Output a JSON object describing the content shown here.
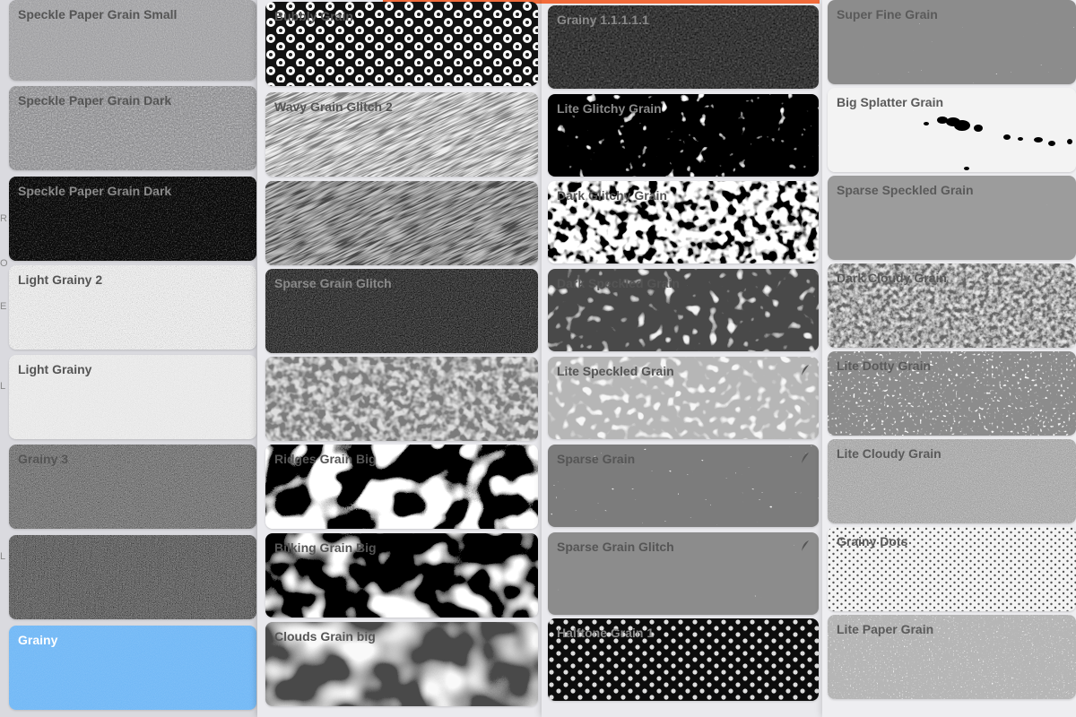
{
  "ui": {
    "accent_color": "#f26b3a",
    "selected_color": "#6ab4f5",
    "edge_letters": [
      "R",
      "O",
      "E",
      "L",
      "L"
    ]
  },
  "columns": [
    {
      "name": "column-1",
      "brushes": [
        {
          "label": "Speckle Paper Grain Small",
          "texture": "gray-speckle-light",
          "selected": false
        },
        {
          "label": "Speckle Paper Grain Dark",
          "texture": "gray-speckle-mid",
          "selected": false
        },
        {
          "label": "Speckle Paper Grain Dark",
          "texture": "dark-speckle",
          "selected": false
        },
        {
          "label": "Light Grainy 2",
          "texture": "light-noise",
          "selected": false
        },
        {
          "label": "Light Grainy",
          "texture": "very-light-noise",
          "selected": false
        },
        {
          "label": "Grainy 3",
          "texture": "mid-noise",
          "selected": false
        },
        {
          "label": "",
          "texture": "mid-noise-dark",
          "selected": false
        },
        {
          "label": "Grainy",
          "texture": "blue-noise",
          "selected": true
        }
      ]
    },
    {
      "name": "column-2",
      "brushes": [
        {
          "label": "Bubbly Grain",
          "texture": "bubbles",
          "selected": false
        },
        {
          "label": "Wavy Grain Glitch 2",
          "texture": "diagonal-streaks-light",
          "selected": false
        },
        {
          "label": "",
          "texture": "diagonal-streaks-dark",
          "selected": false
        },
        {
          "label": "Sparse Grain Glitch",
          "texture": "dark-vignette-noise",
          "selected": false
        },
        {
          "label": "",
          "texture": "mottled-gray",
          "selected": false
        },
        {
          "label": "Ridges Grain Big",
          "texture": "ridges",
          "selected": false
        },
        {
          "label": "Bilking Grain Big",
          "texture": "blobs",
          "selected": false
        },
        {
          "label": "Clouds Grain big",
          "texture": "clouds",
          "selected": false
        }
      ]
    },
    {
      "name": "column-3",
      "brushes": [
        {
          "label": "Grainy 1.1.1.1.1",
          "texture": "dark-paper",
          "selected": false
        },
        {
          "label": "Lite Glitchy Grain",
          "texture": "black-glitch",
          "selected": false
        },
        {
          "label": "Dark Glitchy Grain",
          "texture": "white-glitch",
          "selected": false
        },
        {
          "label": "Dark Speckled Grain",
          "texture": "leopard",
          "selected": false
        },
        {
          "label": "Lite Speckled Grain",
          "texture": "gray-blotch",
          "selected": false
        },
        {
          "label": "Sparse Grain",
          "texture": "sparse-specks",
          "selected": false
        },
        {
          "label": "Sparse Grain Glitch",
          "texture": "sparse-glitch",
          "selected": false
        },
        {
          "label": "Halftone Grain 1",
          "texture": "halftone-dark",
          "selected": false
        }
      ]
    },
    {
      "name": "column-4",
      "brushes": [
        {
          "label": "Super Fine Grain",
          "texture": "super-fine",
          "selected": false
        },
        {
          "label": "Big Splatter Grain",
          "texture": "splatter",
          "selected": false
        },
        {
          "label": "Sparse Speckled Grain",
          "texture": "sparse-speckled",
          "selected": false
        },
        {
          "label": "Dark Cloudy Grain",
          "texture": "dark-cloudy",
          "selected": false
        },
        {
          "label": "Lite Dotty Grain",
          "texture": "dotty",
          "selected": false
        },
        {
          "label": "Lite Cloudy Grain",
          "texture": "lite-cloudy",
          "selected": false
        },
        {
          "label": "Grainy  Dots",
          "texture": "dots",
          "selected": false
        },
        {
          "label": "Lite Paper Grain",
          "texture": "lite-paper",
          "selected": false
        }
      ]
    }
  ]
}
